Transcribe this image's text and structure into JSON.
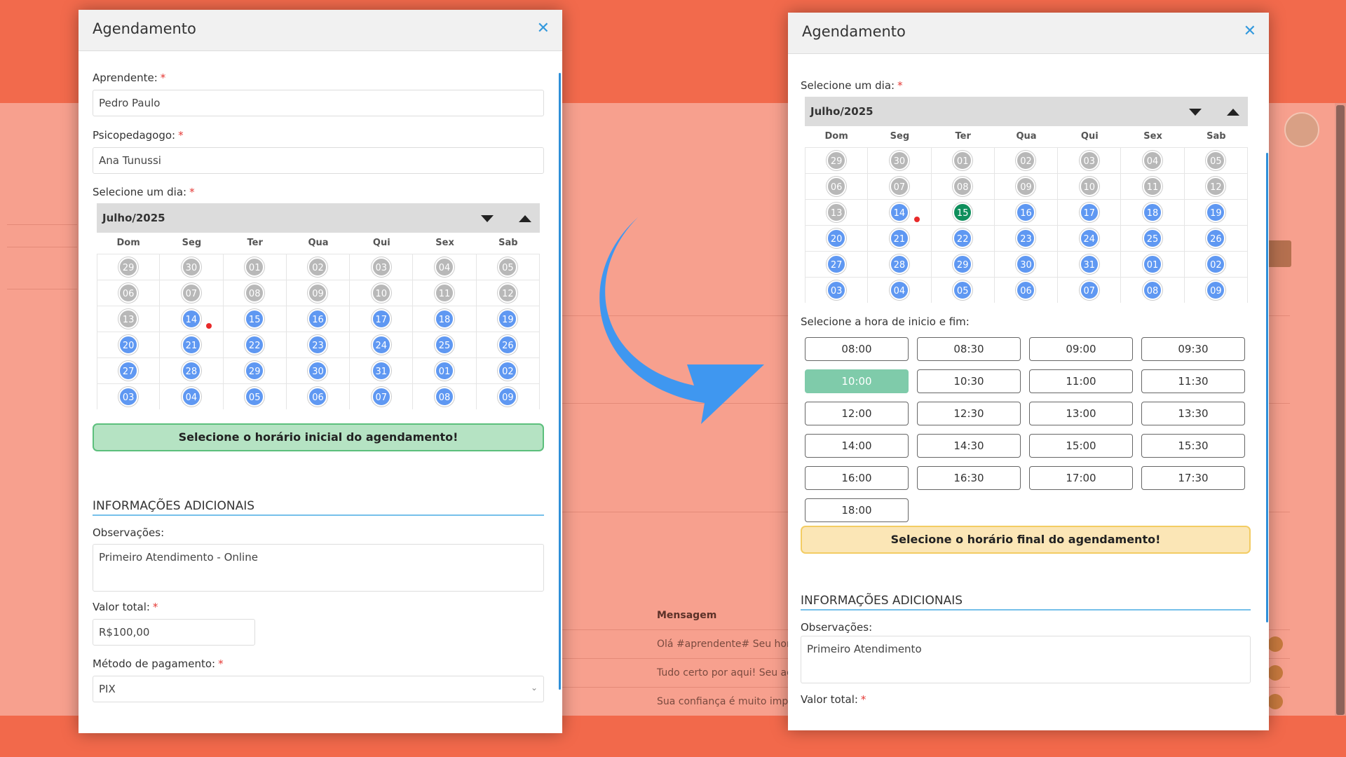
{
  "background": {
    "table_header": "Mensagem",
    "rows": [
      "Olá #aprendente#  Seu horá",
      "Tudo certo por aqui! Seu age",
      "Sua confiança é muito impor"
    ]
  },
  "colors": {
    "accent": "#3399dd",
    "available_day": "#5f98f2",
    "past_day": "#b8b8b8",
    "selected_day": "#0f8f5c",
    "selected_slot": "#7fcbaa"
  },
  "left_modal": {
    "title": "Agendamento",
    "close_icon": "close-icon",
    "aprendente_label": "Aprendente:",
    "aprendente_value": "Pedro Paulo",
    "psico_label": "Psicopedagogo:",
    "psico_value": "Ana Tunussi",
    "day_label": "Selecione um dia:",
    "month": "Julho/2025",
    "weekdays": [
      "Dom",
      "Seg",
      "Ter",
      "Qua",
      "Qui",
      "Sex",
      "Sab"
    ],
    "days": [
      "29",
      "30",
      "01",
      "02",
      "03",
      "04",
      "05",
      "06",
      "07",
      "08",
      "09",
      "10",
      "11",
      "12",
      "13",
      "14",
      "15",
      "16",
      "17",
      "18",
      "19",
      "20",
      "21",
      "22",
      "23",
      "24",
      "25",
      "26",
      "27",
      "28",
      "29",
      "30",
      "31",
      "01",
      "02",
      "03",
      "04",
      "05",
      "06",
      "07",
      "08",
      "09"
    ],
    "first_available_index": 15,
    "selected_index": null,
    "marker_index": 15,
    "banner": "Selecione o horário inicial do agendamento!",
    "section_title": "INFORMAÇÕES ADICIONAIS",
    "obs_label": "Observações:",
    "obs_value": "Primeiro Atendimento - Online",
    "valor_label": "Valor total:",
    "valor_value": "R$100,00",
    "metodo_label": "Método de pagamento:",
    "metodo_value": "PIX",
    "required_mark": "*"
  },
  "right_modal": {
    "title": "Agendamento",
    "close_icon": "close-icon",
    "day_label": "Selecione um dia:",
    "month": "Julho/2025",
    "weekdays": [
      "Dom",
      "Seg",
      "Ter",
      "Qua",
      "Qui",
      "Sex",
      "Sab"
    ],
    "days": [
      "29",
      "30",
      "01",
      "02",
      "03",
      "04",
      "05",
      "06",
      "07",
      "08",
      "09",
      "10",
      "11",
      "12",
      "13",
      "14",
      "15",
      "16",
      "17",
      "18",
      "19",
      "20",
      "21",
      "22",
      "23",
      "24",
      "25",
      "26",
      "27",
      "28",
      "29",
      "30",
      "31",
      "01",
      "02",
      "03",
      "04",
      "05",
      "06",
      "07",
      "08",
      "09"
    ],
    "first_available_index": 15,
    "selected_index": 16,
    "marker_index": 15,
    "time_label": "Selecione a hora de inicio e fim:",
    "slots": [
      "08:00",
      "08:30",
      "09:00",
      "09:30",
      "10:00",
      "10:30",
      "11:00",
      "11:30",
      "12:00",
      "12:30",
      "13:00",
      "13:30",
      "14:00",
      "14:30",
      "15:00",
      "15:30",
      "16:00",
      "16:30",
      "17:00",
      "17:30",
      "18:00"
    ],
    "selected_slot_index": 4,
    "banner": "Selecione o horário final do agendamento!",
    "section_title": "INFORMAÇÕES ADICIONAIS",
    "obs_label": "Observações:",
    "obs_value": "Primeiro Atendimento",
    "valor_label": "Valor total:",
    "required_mark": "*"
  }
}
